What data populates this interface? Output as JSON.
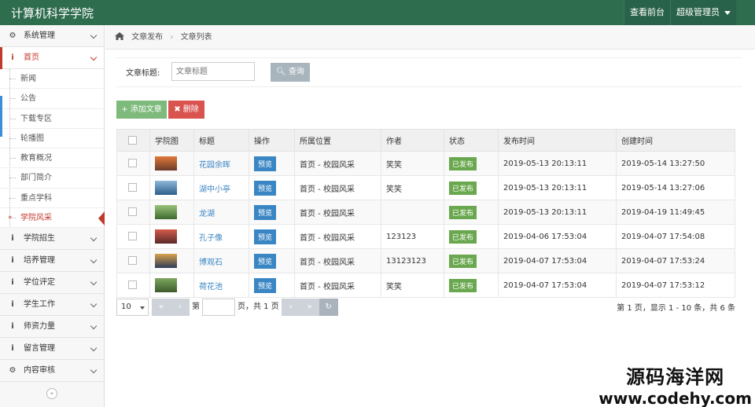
{
  "app": {
    "title": "计算机科学学院"
  },
  "top_actions": {
    "front": "查看前台",
    "admin": "超级管理员"
  },
  "sidebar": {
    "items_top": [
      {
        "label": "系统管理",
        "icon": "gear-icon"
      },
      {
        "label": "首页",
        "icon": "info-icon"
      }
    ],
    "sub_items": [
      "新闻",
      "公告",
      "下载专区",
      "轮播图",
      "教育概况",
      "部门简介",
      "重点学科",
      "学院风采"
    ],
    "items_bottom": [
      {
        "label": "学院招生",
        "icon": "info-icon"
      },
      {
        "label": "培养管理",
        "icon": "info-icon"
      },
      {
        "label": "学位评定",
        "icon": "info-icon"
      },
      {
        "label": "学生工作",
        "icon": "info-icon"
      },
      {
        "label": "师资力量",
        "icon": "info-icon"
      },
      {
        "label": "留言管理",
        "icon": "info-icon"
      },
      {
        "label": "内容审核",
        "icon": "gear-icon"
      }
    ],
    "collapse": "«"
  },
  "breadcrumb": {
    "first": "文章发布",
    "second": "文章列表"
  },
  "search": {
    "label": "文章标题:",
    "placeholder": "文章标题",
    "button": "查询"
  },
  "toolbar": {
    "add": "添加文章",
    "delete": "删除"
  },
  "table": {
    "headers": [
      "",
      "学院图",
      "标题",
      "操作",
      "所属位置",
      "作者",
      "状态",
      "发布时间",
      "创建时间"
    ],
    "rows": [
      {
        "title": "花园余晖",
        "action": "预览",
        "location": "首页 - 校园风采",
        "author": "笑笑",
        "status": "已发布",
        "published": "2019-05-13 20:13:11",
        "created": "2019-05-14 13:27:50"
      },
      {
        "title": "湖中小亭",
        "action": "预览",
        "location": "首页 - 校园风采",
        "author": "笑笑",
        "status": "已发布",
        "published": "2019-05-13 20:13:11",
        "created": "2019-05-14 13:27:06"
      },
      {
        "title": "龙湖",
        "action": "预览",
        "location": "首页 - 校园风采",
        "author": "",
        "status": "已发布",
        "published": "2019-05-13 20:13:11",
        "created": "2019-04-19 11:49:45"
      },
      {
        "title": "孔子像",
        "action": "预览",
        "location": "首页 - 校园风采",
        "author": "123123",
        "status": "已发布",
        "published": "2019-04-06 17:53:04",
        "created": "2019-04-07 17:54:08"
      },
      {
        "title": "博观石",
        "action": "预览",
        "location": "首页 - 校园风采",
        "author": "13123123",
        "status": "已发布",
        "published": "2019-04-07 17:53:04",
        "created": "2019-04-07 17:53:24"
      },
      {
        "title": "荷花池",
        "action": "预览",
        "location": "首页 - 校园风采",
        "author": "笑笑",
        "status": "已发布",
        "published": "2019-04-07 17:53:04",
        "created": "2019-04-07 17:53:12"
      }
    ]
  },
  "pager": {
    "page_size": "10",
    "first": "«",
    "prev": "‹",
    "page_prefix": "第",
    "page_suffix": "页，共 1 页",
    "next": "›",
    "last": "»",
    "refresh": "↻",
    "info": "第 1 页，显示 1 - 10 条，共 6 条"
  },
  "watermark": {
    "line1": "源码海洋网",
    "line2": "www.codehy.com"
  },
  "colors": {
    "topbar": "#2f6d4f",
    "accent_red": "#c0392b",
    "link_blue": "#3a86c4",
    "status_green": "#6aa84f"
  }
}
